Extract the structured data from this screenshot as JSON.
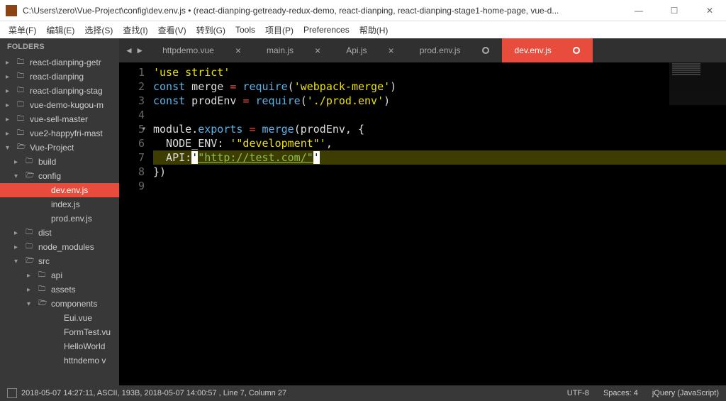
{
  "titlebar": {
    "path": "C:\\Users\\zero\\Vue-Project\\config\\dev.env.js • (react-dianping-getready-redux-demo, react-dianping, react-dianping-stage1-home-page, vue-d..."
  },
  "menu": {
    "file": "菜单(F)",
    "edit": "编辑(E)",
    "select": "选择(S)",
    "find": "查找(I)",
    "view": "查看(V)",
    "goto": "转到(G)",
    "tools": "Tools",
    "project": "项目(P)",
    "preferences": "Preferences",
    "help": "帮助(H)"
  },
  "sidebar": {
    "header": "FOLDERS",
    "items": [
      {
        "label": "react-dianping-getr",
        "type": "folder",
        "indent": 0
      },
      {
        "label": "react-dianping",
        "type": "folder",
        "indent": 0
      },
      {
        "label": "react-dianping-stag",
        "type": "folder",
        "indent": 0
      },
      {
        "label": "vue-demo-kugou-m",
        "type": "folder",
        "indent": 0
      },
      {
        "label": "vue-sell-master",
        "type": "folder",
        "indent": 0
      },
      {
        "label": "vue2-happyfri-mast",
        "type": "folder",
        "indent": 0
      },
      {
        "label": "Vue-Project",
        "type": "folder-open",
        "indent": 0
      },
      {
        "label": "build",
        "type": "folder",
        "indent": 1
      },
      {
        "label": "config",
        "type": "folder-open",
        "indent": 1
      },
      {
        "label": "dev.env.js",
        "type": "file",
        "indent": 2,
        "active": true
      },
      {
        "label": "index.js",
        "type": "file",
        "indent": 2
      },
      {
        "label": "prod.env.js",
        "type": "file",
        "indent": 2
      },
      {
        "label": "dist",
        "type": "folder",
        "indent": 1
      },
      {
        "label": "node_modules",
        "type": "folder",
        "indent": 1
      },
      {
        "label": "src",
        "type": "folder-open",
        "indent": 1
      },
      {
        "label": "api",
        "type": "folder",
        "indent": 2
      },
      {
        "label": "assets",
        "type": "folder",
        "indent": 2
      },
      {
        "label": "components",
        "type": "folder-open",
        "indent": 2
      },
      {
        "label": "Eui.vue",
        "type": "file",
        "indent": 3
      },
      {
        "label": "FormTest.vu",
        "type": "file",
        "indent": 3
      },
      {
        "label": "HelloWorld",
        "type": "file",
        "indent": 3
      },
      {
        "label": "httndemo v",
        "type": "file",
        "indent": 3
      }
    ]
  },
  "tabs": [
    {
      "label": "httpdemo.vue",
      "close": "×"
    },
    {
      "label": "main.js",
      "close": "×"
    },
    {
      "label": "Api.js",
      "close": "×"
    },
    {
      "label": "prod.env.js",
      "dirty": true
    },
    {
      "label": "dev.env.js",
      "dirty": true,
      "active": true
    }
  ],
  "code": {
    "lines": [
      {
        "n": "1"
      },
      {
        "n": "2"
      },
      {
        "n": "3"
      },
      {
        "n": "4"
      },
      {
        "n": "5"
      },
      {
        "n": "6"
      },
      {
        "n": "7"
      },
      {
        "n": "8"
      },
      {
        "n": "9"
      }
    ],
    "l1_str": "'use strict'",
    "l2_kw": "const",
    "l2_var": " merge ",
    "l2_op": "=",
    "l2_fn": " require",
    "l2_p1": "(",
    "l2_arg": "'webpack-merge'",
    "l2_p2": ")",
    "l3_kw": "const",
    "l3_var": " prodEnv ",
    "l3_op": "=",
    "l3_fn": " require",
    "l3_p1": "(",
    "l3_arg": "'./prod.env'",
    "l3_p2": ")",
    "l5_a": "module",
    "l5_dot": ".",
    "l5_b": "exports ",
    "l5_op": "=",
    "l5_fn": " merge",
    "l5_rest": "(prodEnv, {",
    "l6_key": "  NODE_ENV",
    "l6_colon": ": ",
    "l6_val": "'\"development\"'",
    "l6_comma": ",",
    "l7_key": "  API",
    "l7_colon": ":",
    "l7_q1": "'",
    "l7_url": "\"http://test.com/\"",
    "l7_q2": "'",
    "l8": "})"
  },
  "status": {
    "left": "2018-05-07 14:27:11, ASCII, 193B, 2018-05-07 14:00:57 , Line 7, Column 27",
    "encoding": "UTF-8",
    "spaces": "Spaces: 4",
    "syntax": "jQuery (JavaScript)"
  }
}
